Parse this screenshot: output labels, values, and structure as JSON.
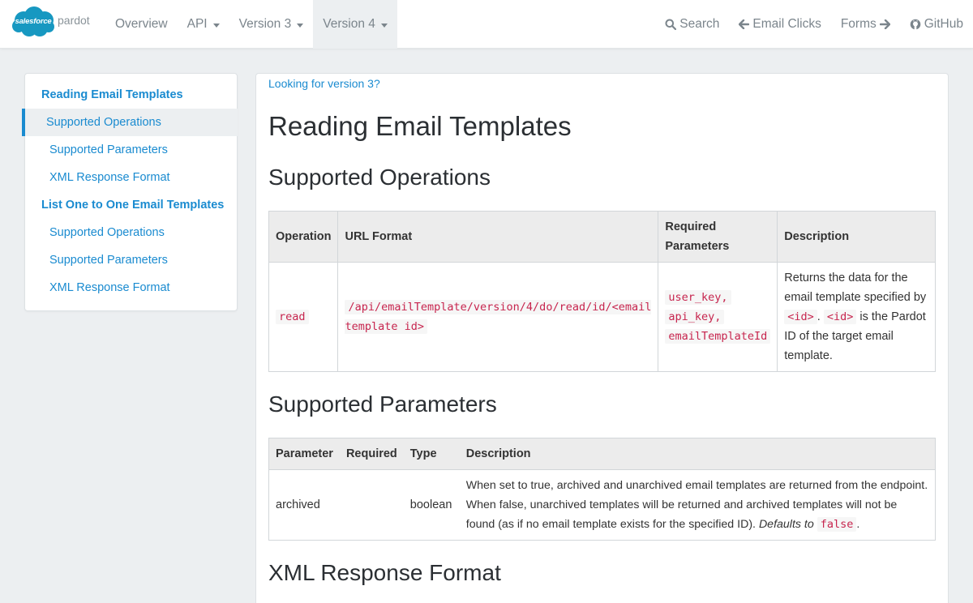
{
  "brand": {
    "logo_text": "salesforce",
    "product": "pardot",
    "logo_color": "#1798c1"
  },
  "nav": {
    "overview": "Overview",
    "api": "API",
    "version3": "Version 3",
    "version4": "Version 4",
    "search": "Search",
    "email_clicks": "Email Clicks",
    "forms": "Forms",
    "github": "GitHub"
  },
  "sidebar": {
    "items": [
      {
        "label": "Reading Email Templates"
      },
      {
        "label": "Supported Operations"
      },
      {
        "label": "Supported Parameters"
      },
      {
        "label": "XML Response Format"
      },
      {
        "label": "List One to One Email Templates"
      },
      {
        "label": "Supported Operations"
      },
      {
        "label": "Supported Parameters"
      },
      {
        "label": "XML Response Format"
      }
    ]
  },
  "main": {
    "version_link": "Looking for version 3?",
    "title": "Reading Email Templates",
    "sections": {
      "ops": "Supported Operations",
      "params": "Supported Parameters",
      "xml": "XML Response Format"
    },
    "ops_table": {
      "headers": [
        "Operation",
        "URL Format",
        "Required Parameters",
        "Description"
      ],
      "row": {
        "operation": "read",
        "url": "/api/emailTemplate/version/4/do/read/id/<email template id>",
        "required": [
          "user_key,",
          "api_key,",
          "emailTemplateId"
        ],
        "desc_1": "Returns the data for the email template specified by",
        "desc_code1": "<id>",
        "desc_2": ".",
        "desc_code2": "<id>",
        "desc_3": "is the Pardot ID of the target email template."
      }
    },
    "params_table": {
      "headers": [
        "Parameter",
        "Required",
        "Type",
        "Description"
      ],
      "row": {
        "parameter": "archived",
        "required": "",
        "type": "boolean",
        "desc": "When set to true, archived and unarchived email templates are returned from the endpoint. When false, unarchived templates will be returned and archived templates will not be found (as if no email template exists for the specified ID).",
        "defaults_label": "Defaults to",
        "defaults_value": "false",
        "defaults_end": "."
      }
    }
  },
  "colors": {
    "link": "#1a8bd0",
    "code": "#c7254e",
    "page_bg": "#eceff1"
  }
}
